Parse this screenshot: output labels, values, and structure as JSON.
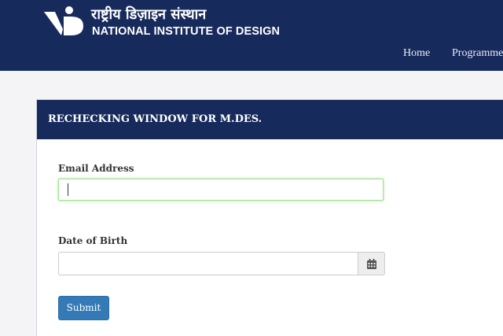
{
  "header": {
    "logo_icon": "nid-logo-icon",
    "logo_hindi": "राष्ट्रीय डिज़ाइन संस्थान",
    "logo_english": "NATIONAL INSTITUTE OF DESIGN",
    "nav": {
      "home": "Home",
      "programmes": "Programme"
    }
  },
  "panel": {
    "title": "RECHECKING WINDOW FOR M.DES."
  },
  "form": {
    "email_label": "Email Address",
    "email_value": "",
    "dob_label": "Date of Birth",
    "dob_value": "",
    "calendar_icon": "calendar-icon",
    "submit_label": "Submit"
  },
  "colors": {
    "brand_navy": "#172a5c",
    "button_blue": "#337ab7",
    "focus_green": "#9fe28f"
  }
}
